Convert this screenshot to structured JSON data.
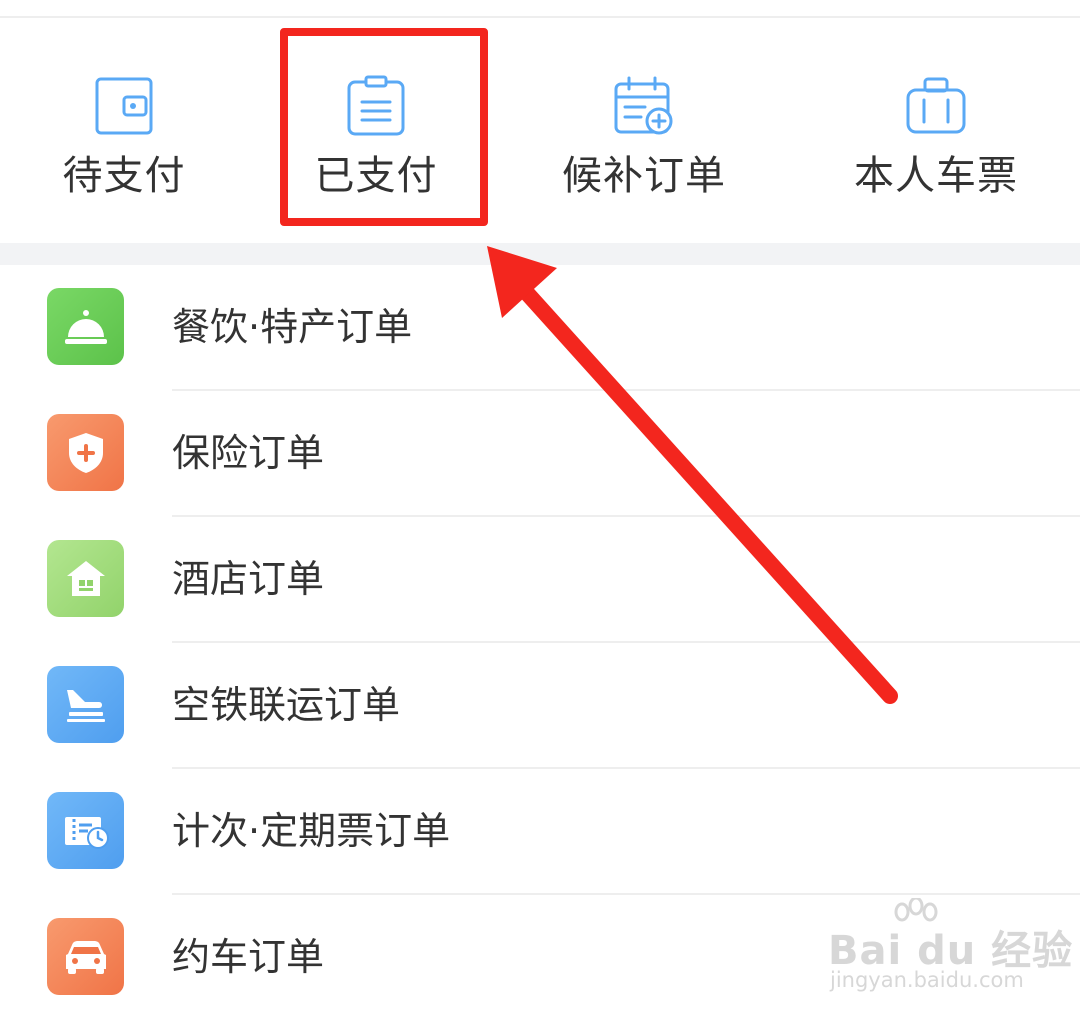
{
  "quick_actions": [
    {
      "label": "待支付",
      "icon": "wallet-icon"
    },
    {
      "label": "已支付",
      "icon": "clipboard-icon"
    },
    {
      "label": "候补订单",
      "icon": "calendar-add-icon"
    },
    {
      "label": "本人车票",
      "icon": "luggage-icon"
    }
  ],
  "order_list": [
    {
      "label": "餐饮·特产订单",
      "icon": "service-bell-icon",
      "color": "#6dcf5a"
    },
    {
      "label": "保险订单",
      "icon": "shield-plus-icon",
      "color": "#f5845b"
    },
    {
      "label": "酒店订单",
      "icon": "house-icon",
      "color": "#a4de7e"
    },
    {
      "label": "空铁联运订单",
      "icon": "plane-train-icon",
      "color": "#5aa9f5"
    },
    {
      "label": "计次·定期票订单",
      "icon": "ticket-clock-icon",
      "color": "#5aa9f5"
    },
    {
      "label": "约车订单",
      "icon": "car-icon",
      "color": "#f5845b"
    }
  ],
  "colors": {
    "accent_blue": "#5aa9f5",
    "highlight_red": "#f3261e",
    "text": "#333333"
  },
  "watermark": {
    "main": "Bai du 经验",
    "sub": "jingyan.baidu.com"
  }
}
